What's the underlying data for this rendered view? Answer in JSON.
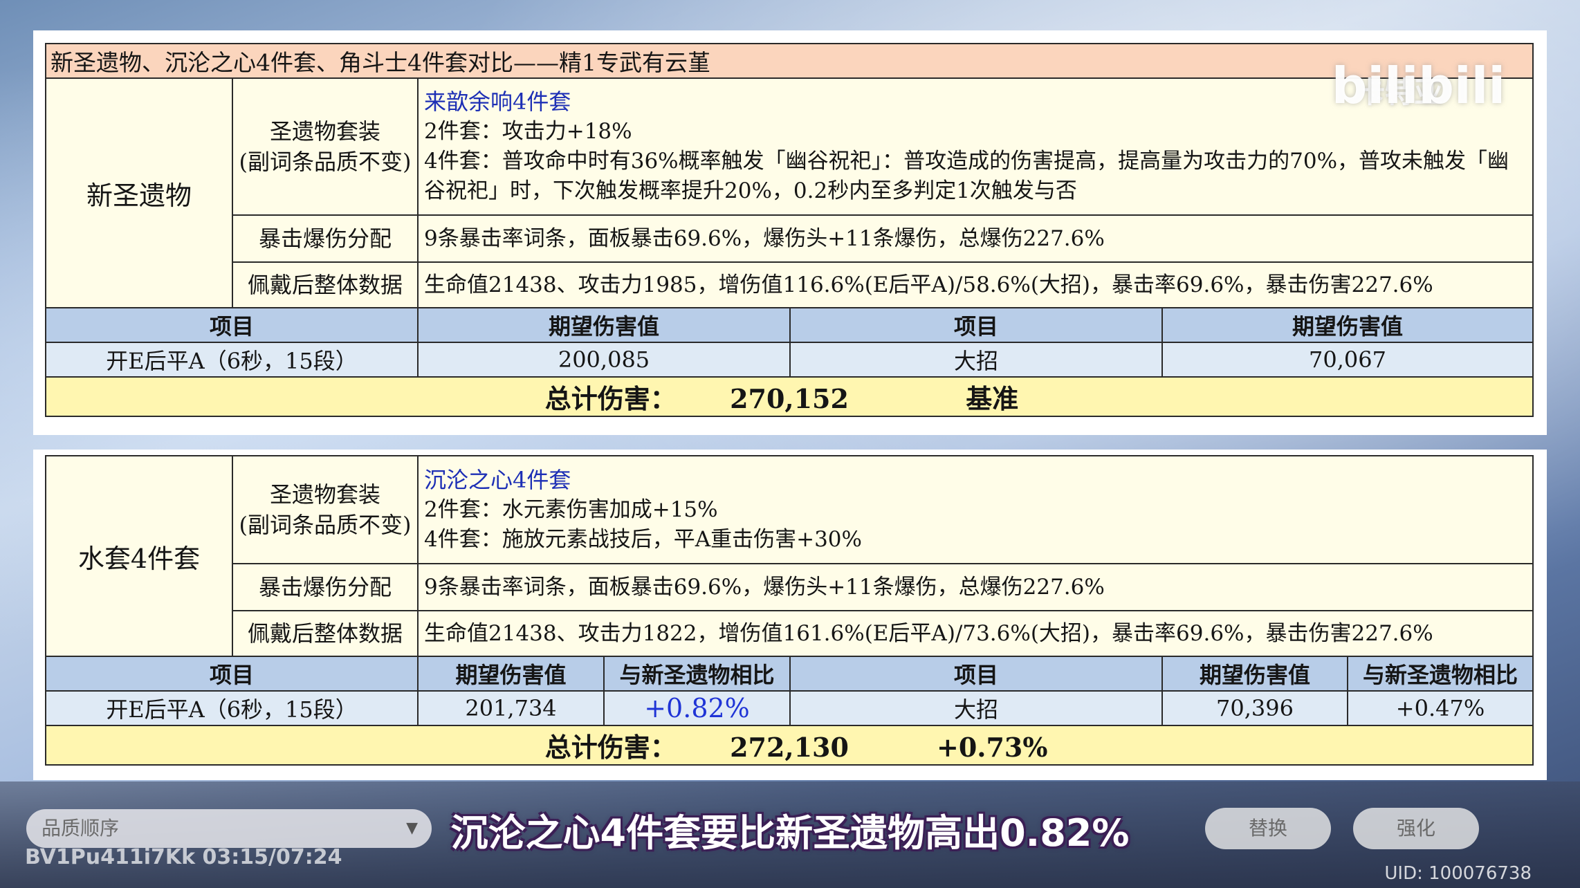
{
  "header": {
    "title": "新圣遗物、沉沦之心4件套、角斗士4件套对比——精1专武有云堇",
    "watermark_author": "卡特亚"
  },
  "logo_text": "bilibili",
  "section1": {
    "label": "新圣遗物",
    "set_row_label_1": "圣遗物套装",
    "set_row_label_2": "(副词条品质不变)",
    "set_name": "来歆余响4件套",
    "set_2pc": "2件套：攻击力+18%",
    "set_4pc": "4件套：普攻命中时有36%概率触发「幽谷祝祀」：普攻造成的伤害提高，提高量为攻击力的70%，普攻未触发「幽谷祝祀」时，下次触发概率提升20%，0.2秒内至多判定1次触发与否",
    "crit_label": "暴击爆伤分配",
    "crit_text": "9条暴击率词条，面板暴击69.6%，爆伤头+11条爆伤，总爆伤227.6%",
    "stats_label": "佩戴后整体数据",
    "stats_text": "生命值21438、攻击力1985，增伤值116.6%(E后平A)/58.6%(大招)，暴击率69.6%，暴击伤害227.6%",
    "headers": [
      "项目",
      "期望伤害值",
      "项目",
      "期望伤害值"
    ],
    "row": [
      "开E后平A（6秒，15段）",
      "200,085",
      "大招",
      "70,067"
    ],
    "total_label": "总计伤害：",
    "total_value": "270,152",
    "total_note": "基准"
  },
  "section2": {
    "label": "水套4件套",
    "set_row_label_1": "圣遗物套装",
    "set_row_label_2": "(副词条品质不变)",
    "set_name": "沉沦之心4件套",
    "set_2pc": "2件套：水元素伤害加成+15%",
    "set_4pc": "4件套：施放元素战技后，平A重击伤害+30%",
    "crit_label": "暴击爆伤分配",
    "crit_text": "9条暴击率词条，面板暴击69.6%，爆伤头+11条爆伤，总爆伤227.6%",
    "stats_label": "佩戴后整体数据",
    "stats_text": "生命值21438、攻击力1822，增伤值161.6%(E后平A)/73.6%(大招)，暴击率69.6%，暴击伤害227.6%",
    "headers": [
      "项目",
      "期望伤害值",
      "与新圣遗物相比",
      "项目",
      "期望伤害值",
      "与新圣遗物相比"
    ],
    "row": [
      "开E后平A（6秒，15段）",
      "201,734",
      "+0.82%",
      "大招",
      "70,396",
      "+0.47%"
    ],
    "total_label": "总计伤害：",
    "total_value": "272,130",
    "total_note": "+0.73%"
  },
  "game_ui": {
    "sort_label": "品质顺序",
    "replace_button": "替换",
    "enhance_button": "强化",
    "uid": "UID: 100076738"
  },
  "video": {
    "subtitle": "沉沦之心4件套要比新圣遗物高出0.82%",
    "bv_timestamp": "BV1Pu411i7Kk 03:15/07:24"
  },
  "colors": {
    "title_bg": "#fbd5bd",
    "section_bg": "#fffde8",
    "header_bg": "#b8cde8",
    "data_bg": "#dfeaf5",
    "total_bg": "#fff6b0",
    "set_name_color": "#1d2fb5"
  }
}
